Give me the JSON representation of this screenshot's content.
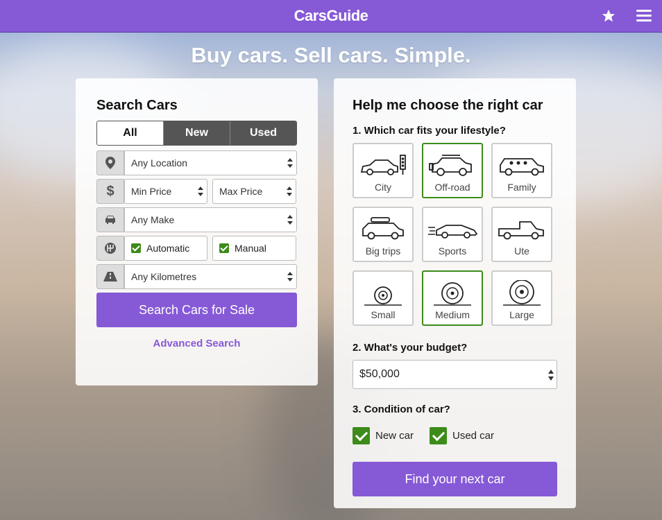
{
  "header": {
    "logo_part1": "Cars",
    "logo_part2": "Guide",
    "favourites_icon": "star-icon",
    "menu_icon": "hamburger-menu-icon",
    "bg_color": "#8659d6"
  },
  "hero": {
    "title": "Buy cars. Sell cars. Simple."
  },
  "search": {
    "title": "Search Cars",
    "tabs": [
      {
        "label": "All",
        "active": true
      },
      {
        "label": "New",
        "active": false
      },
      {
        "label": "Used",
        "active": false
      }
    ],
    "location": {
      "icon": "location-pin-icon",
      "value": "Any Location"
    },
    "price": {
      "icon": "dollar-icon",
      "min": "Min Price",
      "max": "Max Price"
    },
    "make": {
      "icon": "car-icon",
      "value": "Any Make"
    },
    "transmission": {
      "icon": "gearbox-icon",
      "automatic": "Automatic",
      "manual": "Manual",
      "automatic_checked": true,
      "manual_checked": true
    },
    "kilometres": {
      "icon": "road-icon",
      "value": "Any Kilometres"
    },
    "submit_label": "Search Cars for Sale",
    "advanced_link": "Advanced Search"
  },
  "helper": {
    "title": "Help me choose the right car",
    "q1": "1. Which car fits your lifestyle?",
    "lifestyle": [
      {
        "label": "City",
        "icon": "city-car-icon",
        "selected": false
      },
      {
        "label": "Off-road",
        "icon": "offroad-car-icon",
        "selected": true
      },
      {
        "label": "Family",
        "icon": "family-car-icon",
        "selected": false
      },
      {
        "label": "Big trips",
        "icon": "roofbox-car-icon",
        "selected": false
      },
      {
        "label": "Sports",
        "icon": "sports-car-icon",
        "selected": false
      },
      {
        "label": "Ute",
        "icon": "ute-icon",
        "selected": false
      },
      {
        "label": "Small",
        "icon": "small-wheel-icon",
        "selected": false
      },
      {
        "label": "Medium",
        "icon": "medium-wheel-icon",
        "selected": true
      },
      {
        "label": "Large",
        "icon": "large-wheel-icon",
        "selected": false
      }
    ],
    "q2": "2. What's your budget?",
    "budget": "$50,000",
    "q3": "3. Condition of car?",
    "new_car": "New car",
    "used_car": "Used car",
    "new_checked": true,
    "used_checked": true,
    "submit_label": "Find your next car"
  },
  "colors": {
    "accent": "#8659d6",
    "check": "#3d8b1a"
  }
}
